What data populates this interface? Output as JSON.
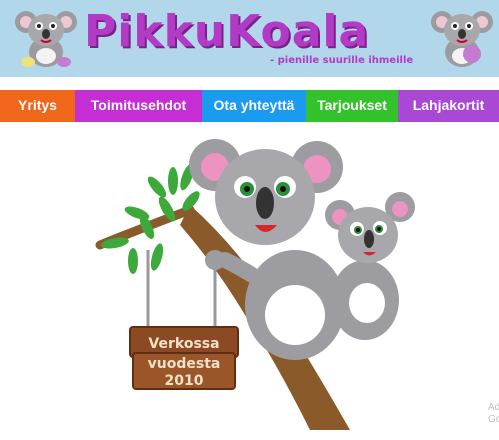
{
  "header": {
    "logo_main": "PikkuKoala",
    "logo_slogan": "- pienille suurille ihmeille"
  },
  "nav": {
    "items": [
      {
        "label": "Yritys",
        "color": "#f0661a"
      },
      {
        "label": "Toimitusehdot",
        "color": "#c42ed3"
      },
      {
        "label": "Ota yhteyttä",
        "color": "#1a9bf0"
      },
      {
        "label": "Tarjoukset",
        "color": "#33c22c"
      },
      {
        "label": "Lahjakortit",
        "color": "#a848d4"
      }
    ]
  },
  "hero": {
    "sign_line1": "Verkossa",
    "sign_line2": "vuodesta",
    "sign_line3": "2010"
  },
  "ad": {
    "line1": "Ad",
    "line2": "Go"
  }
}
